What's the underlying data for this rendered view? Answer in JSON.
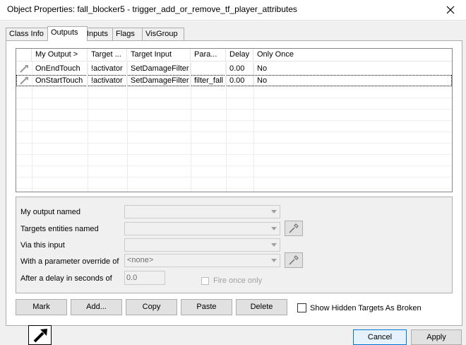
{
  "window": {
    "title": "Object Properties: fall_blocker5 - trigger_add_or_remove_tf_player_attributes",
    "close_icon": "close-icon"
  },
  "tabs": [
    {
      "label": "Class Info",
      "active": false
    },
    {
      "label": "Outputs",
      "active": true
    },
    {
      "label": "Inputs",
      "active": false
    },
    {
      "label": "Flags",
      "active": false
    },
    {
      "label": "VisGroup",
      "active": false
    }
  ],
  "outputs_table": {
    "columns": [
      "My Output  >",
      "Target ...",
      "Target Input",
      "Para...",
      "Delay",
      "Only Once"
    ],
    "rows": [
      {
        "my_output": "OnEndTouch",
        "target": "!activator",
        "target_input": "SetDamageFilter",
        "param": "",
        "delay": "0.00",
        "only_once": "No",
        "selected": false
      },
      {
        "my_output": "OnStartTouch",
        "target": "!activator",
        "target_input": "SetDamageFilter",
        "param": "filter_fall",
        "delay": "0.00",
        "only_once": "No",
        "selected": true
      }
    ]
  },
  "properties": {
    "output_named_label": "My output named",
    "output_named_value": "",
    "targets_label": "Targets entities named",
    "targets_value": "",
    "via_input_label": "Via this input",
    "via_input_value": "",
    "param_override_label": "With a parameter override of",
    "param_override_value": "<none>",
    "delay_label": "After a delay in seconds of",
    "delay_value": "0.0",
    "fire_once_label": "Fire once only"
  },
  "buttons": {
    "mark": "Mark",
    "add": "Add...",
    "copy": "Copy",
    "paste": "Paste",
    "delete": "Delete",
    "cancel": "Cancel",
    "apply": "Apply"
  },
  "show_hidden_label": "Show Hidden Targets As Broken",
  "colors": {
    "window_bg": "#f0f0f0",
    "button_bg": "#e1e1e1",
    "border": "#adadad"
  }
}
